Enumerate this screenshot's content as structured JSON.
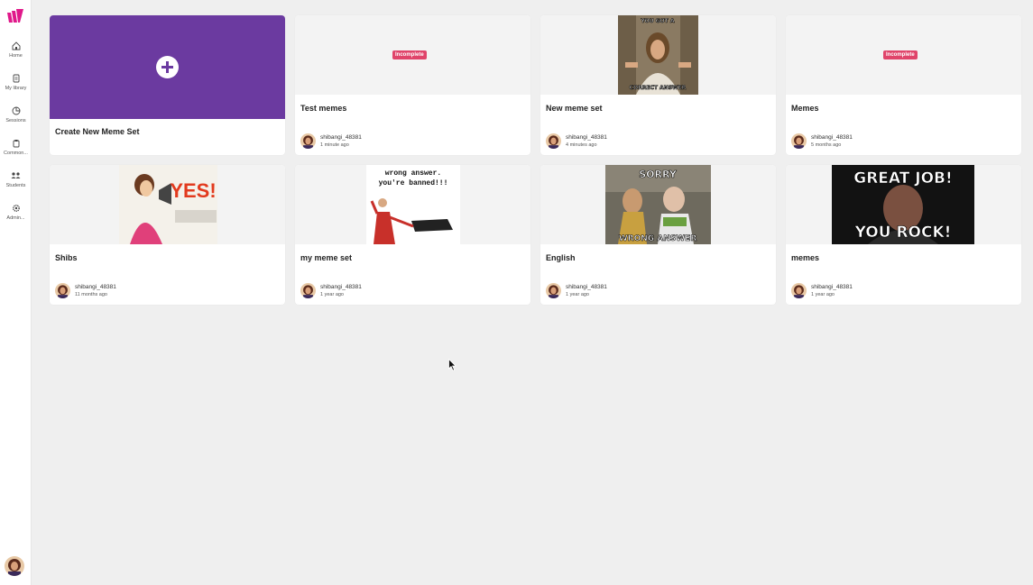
{
  "sidebar": {
    "items": [
      {
        "label": "Home",
        "icon": "home-icon"
      },
      {
        "label": "My library",
        "icon": "library-icon"
      },
      {
        "label": "Sessions",
        "icon": "sessions-icon"
      },
      {
        "label": "Common...",
        "icon": "clipboard-icon"
      },
      {
        "label": "Students",
        "icon": "students-icon"
      },
      {
        "label": "Admin...",
        "icon": "gear-icon"
      }
    ]
  },
  "create": {
    "label": "Create New Meme Set"
  },
  "badge_label": "Incomplete",
  "cards": [
    {
      "title": "Test memes",
      "owner": "shibangi_48381",
      "time": "1 minute ago",
      "incomplete": true
    },
    {
      "title": "New meme set",
      "owner": "shibangi_48381",
      "time": "4 minutes ago",
      "meme_top": "YOU GOT A",
      "meme_bottom": "CORRECT ANSWER"
    },
    {
      "title": "Memes",
      "owner": "shibangi_48381",
      "time": "5 months ago",
      "incomplete": true
    },
    {
      "title": "Shibs",
      "owner": "shibangi_48381",
      "time": "11 months ago",
      "meme_top": "YES!"
    },
    {
      "title": "my meme set",
      "owner": "shibangi_48381",
      "time": "1 year ago",
      "meme_top": "wrong answer.",
      "meme_bottom": "you're banned!!!"
    },
    {
      "title": "English",
      "owner": "shibangi_48381",
      "time": "1 year ago",
      "meme_top": "SORRY",
      "meme_bottom": "WRONG ANSWER"
    },
    {
      "title": "memes",
      "owner": "shibangi_48381",
      "time": "1 year ago",
      "meme_top": "GREAT JOB!",
      "meme_bottom": "YOU ROCK!"
    }
  ],
  "colors": {
    "brand": "#e0188a",
    "create_bg": "#6b3aa0",
    "badge": "#e0446a",
    "page_bg": "#efefef"
  }
}
